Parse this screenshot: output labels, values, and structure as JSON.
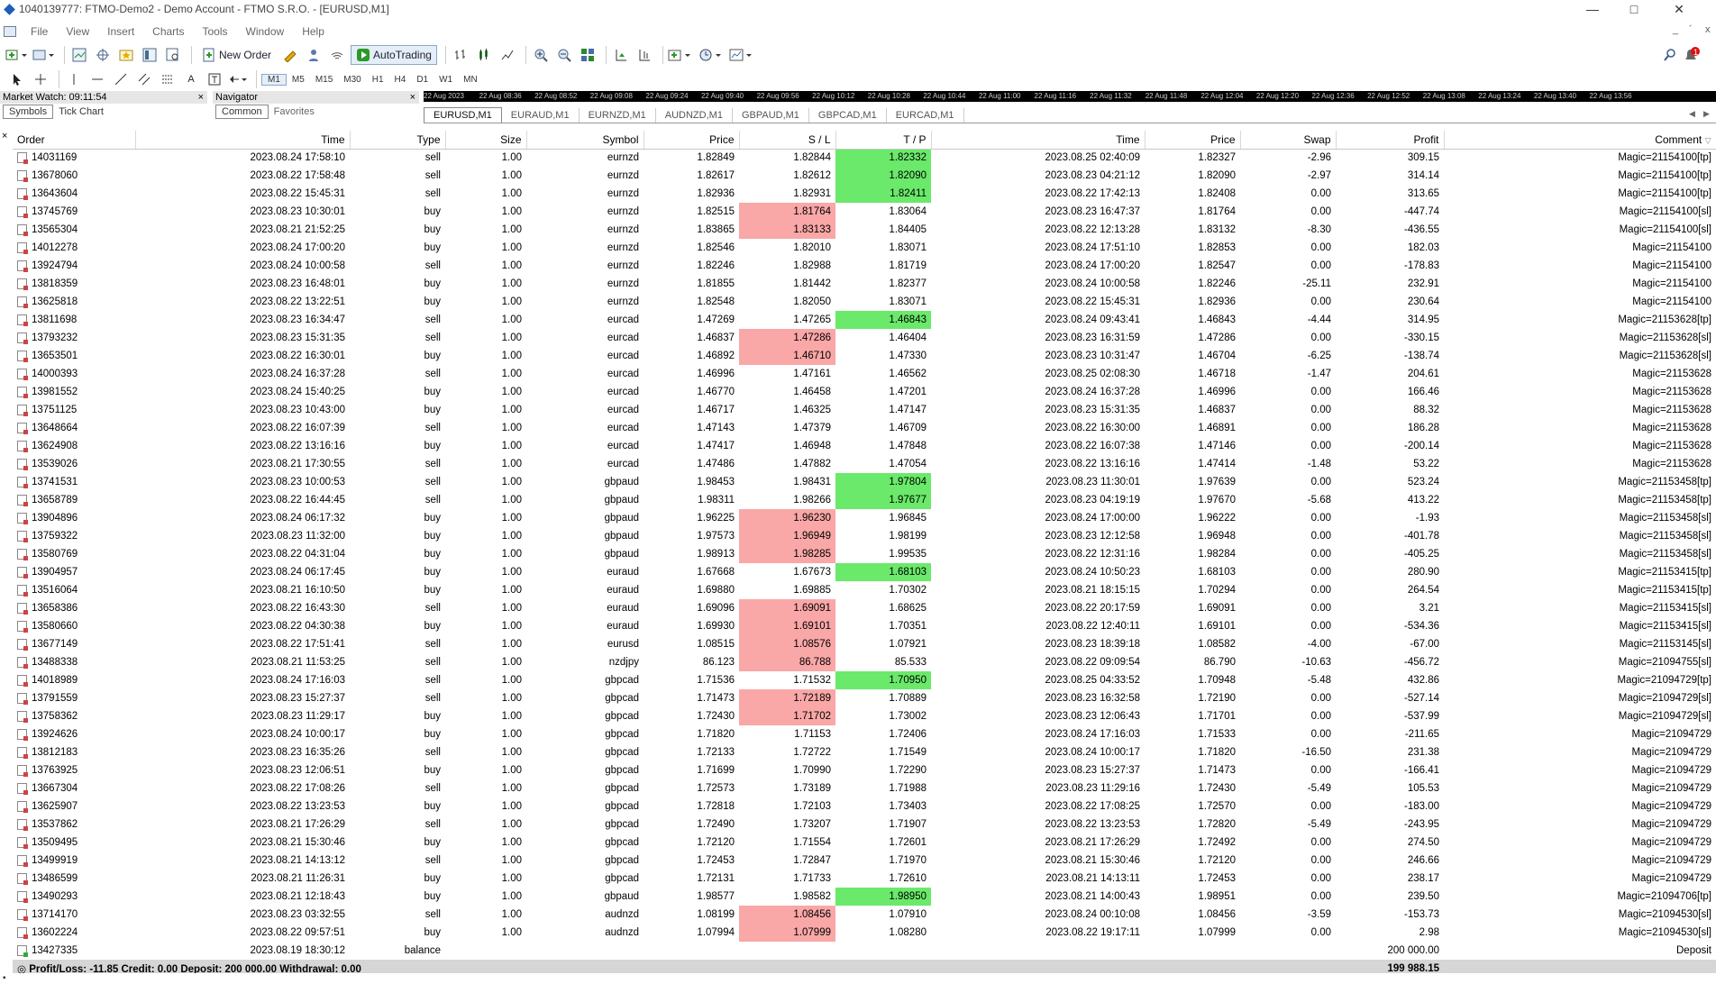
{
  "window": {
    "title": "1040139777: FTMO-Demo2 - Demo Account - FTMO S.R.O. - [EURUSD,M1]",
    "controls": [
      "—",
      "□",
      "✕"
    ]
  },
  "menu": {
    "items": [
      "File",
      "View",
      "Insert",
      "Charts",
      "Tools",
      "Window",
      "Help"
    ],
    "right_controls": [
      "_",
      "´",
      "x"
    ]
  },
  "toolbar": {
    "new_order_label": "New Order",
    "autotrading_label": "AutoTrading",
    "notification_badge": "1"
  },
  "timeframes": [
    "M1",
    "M5",
    "M15",
    "M30",
    "H1",
    "H4",
    "D1",
    "W1",
    "MN"
  ],
  "market_watch": {
    "title": "Market Watch: 09:11:54",
    "tabs": [
      "Symbols",
      "Tick Chart"
    ]
  },
  "navigator": {
    "title": "Navigator",
    "tabs": [
      "Common",
      "Favorites"
    ]
  },
  "chart_strip_times": [
    "22 Aug 2023",
    "22 Aug 08:36",
    "22 Aug 08:52",
    "22 Aug 09:08",
    "22 Aug 09:24",
    "22 Aug 09:40",
    "22 Aug 09:56",
    "22 Aug 10:12",
    "22 Aug 10:28",
    "22 Aug 10:44",
    "22 Aug 11:00",
    "22 Aug 11:16",
    "22 Aug 11:32",
    "22 Aug 11:48",
    "22 Aug 12:04",
    "22 Aug 12:20",
    "22 Aug 12:36",
    "22 Aug 12:52",
    "22 Aug 13:08",
    "22 Aug 13:24",
    "22 Aug 13:40",
    "22 Aug 13:56"
  ],
  "chart_tabs": [
    "EURUSD,M1",
    "EURAUD,M1",
    "EURNZD,M1",
    "AUDNZD,M1",
    "GBPAUD,M1",
    "GBPCAD,M1",
    "EURCAD,M1"
  ],
  "columns": [
    "Order",
    "Time",
    "Type",
    "Size",
    "Symbol",
    "Price",
    "S / L",
    "T / P",
    "Time",
    "Price",
    "Swap",
    "Profit",
    "Comment"
  ],
  "rows": [
    [
      "14031169",
      "2023.08.24 17:58:10",
      "sell",
      "1.00",
      "eurnzd",
      "1.82849",
      "1.82844",
      "1.82332",
      "2023.08.25 02:40:09",
      "1.82327",
      "-2.96",
      "309.15",
      "Magic=21154100[tp]",
      "",
      "tp"
    ],
    [
      "13678060",
      "2023.08.22 17:58:48",
      "sell",
      "1.00",
      "eurnzd",
      "1.82617",
      "1.82612",
      "1.82090",
      "2023.08.23 04:21:12",
      "1.82090",
      "-2.97",
      "314.14",
      "Magic=21154100[tp]",
      "",
      "tp"
    ],
    [
      "13643604",
      "2023.08.22 15:45:31",
      "sell",
      "1.00",
      "eurnzd",
      "1.82936",
      "1.82931",
      "1.82411",
      "2023.08.22 17:42:13",
      "1.82408",
      "0.00",
      "313.65",
      "Magic=21154100[tp]",
      "",
      "tp"
    ],
    [
      "13745769",
      "2023.08.23 10:30:01",
      "buy",
      "1.00",
      "eurnzd",
      "1.82515",
      "1.81764",
      "1.83064",
      "2023.08.23 16:47:37",
      "1.81764",
      "0.00",
      "-447.74",
      "Magic=21154100[sl]",
      "sl",
      ""
    ],
    [
      "13565304",
      "2023.08.21 21:52:25",
      "buy",
      "1.00",
      "eurnzd",
      "1.83865",
      "1.83133",
      "1.84405",
      "2023.08.22 12:13:28",
      "1.83132",
      "-8.30",
      "-436.55",
      "Magic=21154100[sl]",
      "sl",
      ""
    ],
    [
      "14012278",
      "2023.08.24 17:00:20",
      "buy",
      "1.00",
      "eurnzd",
      "1.82546",
      "1.82010",
      "1.83071",
      "2023.08.24 17:51:10",
      "1.82853",
      "0.00",
      "182.03",
      "Magic=21154100",
      "",
      ""
    ],
    [
      "13924794",
      "2023.08.24 10:00:58",
      "sell",
      "1.00",
      "eurnzd",
      "1.82246",
      "1.82988",
      "1.81719",
      "2023.08.24 17:00:20",
      "1.82547",
      "0.00",
      "-178.83",
      "Magic=21154100",
      "",
      ""
    ],
    [
      "13818359",
      "2023.08.23 16:48:01",
      "buy",
      "1.00",
      "eurnzd",
      "1.81855",
      "1.81442",
      "1.82377",
      "2023.08.24 10:00:58",
      "1.82246",
      "-25.11",
      "232.91",
      "Magic=21154100",
      "",
      ""
    ],
    [
      "13625818",
      "2023.08.22 13:22:51",
      "buy",
      "1.00",
      "eurnzd",
      "1.82548",
      "1.82050",
      "1.83071",
      "2023.08.22 15:45:31",
      "1.82936",
      "0.00",
      "230.64",
      "Magic=21154100",
      "",
      ""
    ],
    [
      "13811698",
      "2023.08.23 16:34:47",
      "sell",
      "1.00",
      "eurcad",
      "1.47269",
      "1.47265",
      "1.46843",
      "2023.08.24 09:43:41",
      "1.46843",
      "-4.44",
      "314.95",
      "Magic=21153628[tp]",
      "",
      "tp"
    ],
    [
      "13793232",
      "2023.08.23 15:31:35",
      "sell",
      "1.00",
      "eurcad",
      "1.46837",
      "1.47286",
      "1.46404",
      "2023.08.23 16:31:59",
      "1.47286",
      "0.00",
      "-330.15",
      "Magic=21153628[sl]",
      "sl",
      ""
    ],
    [
      "13653501",
      "2023.08.22 16:30:01",
      "buy",
      "1.00",
      "eurcad",
      "1.46892",
      "1.46710",
      "1.47330",
      "2023.08.23 10:31:47",
      "1.46704",
      "-6.25",
      "-138.74",
      "Magic=21153628[sl]",
      "sl",
      ""
    ],
    [
      "14000393",
      "2023.08.24 16:37:28",
      "sell",
      "1.00",
      "eurcad",
      "1.46996",
      "1.47161",
      "1.46562",
      "2023.08.25 02:08:30",
      "1.46718",
      "-1.47",
      "204.61",
      "Magic=21153628",
      "",
      ""
    ],
    [
      "13981552",
      "2023.08.24 15:40:25",
      "buy",
      "1.00",
      "eurcad",
      "1.46770",
      "1.46458",
      "1.47201",
      "2023.08.24 16:37:28",
      "1.46996",
      "0.00",
      "166.46",
      "Magic=21153628",
      "",
      ""
    ],
    [
      "13751125",
      "2023.08.23 10:43:00",
      "buy",
      "1.00",
      "eurcad",
      "1.46717",
      "1.46325",
      "1.47147",
      "2023.08.23 15:31:35",
      "1.46837",
      "0.00",
      "88.32",
      "Magic=21153628",
      "",
      ""
    ],
    [
      "13648664",
      "2023.08.22 16:07:39",
      "sell",
      "1.00",
      "eurcad",
      "1.47143",
      "1.47379",
      "1.46709",
      "2023.08.22 16:30:00",
      "1.46891",
      "0.00",
      "186.28",
      "Magic=21153628",
      "",
      ""
    ],
    [
      "13624908",
      "2023.08.22 13:16:16",
      "buy",
      "1.00",
      "eurcad",
      "1.47417",
      "1.46948",
      "1.47848",
      "2023.08.22 16:07:38",
      "1.47146",
      "0.00",
      "-200.14",
      "Magic=21153628",
      "",
      ""
    ],
    [
      "13539026",
      "2023.08.21 17:30:55",
      "sell",
      "1.00",
      "eurcad",
      "1.47486",
      "1.47882",
      "1.47054",
      "2023.08.22 13:16:16",
      "1.47414",
      "-1.48",
      "53.22",
      "Magic=21153628",
      "",
      ""
    ],
    [
      "13741531",
      "2023.08.23 10:00:53",
      "sell",
      "1.00",
      "gbpaud",
      "1.98453",
      "1.98431",
      "1.97804",
      "2023.08.23 11:30:01",
      "1.97639",
      "0.00",
      "523.24",
      "Magic=21153458[tp]",
      "",
      "tp"
    ],
    [
      "13658789",
      "2023.08.22 16:44:45",
      "sell",
      "1.00",
      "gbpaud",
      "1.98311",
      "1.98266",
      "1.97677",
      "2023.08.23 04:19:19",
      "1.97670",
      "-5.68",
      "413.22",
      "Magic=21153458[tp]",
      "",
      "tp"
    ],
    [
      "13904896",
      "2023.08.24 06:17:32",
      "buy",
      "1.00",
      "gbpaud",
      "1.96225",
      "1.96230",
      "1.96845",
      "2023.08.24 17:00:00",
      "1.96222",
      "0.00",
      "-1.93",
      "Magic=21153458[sl]",
      "sl",
      ""
    ],
    [
      "13759322",
      "2023.08.23 11:32:00",
      "buy",
      "1.00",
      "gbpaud",
      "1.97573",
      "1.96949",
      "1.98199",
      "2023.08.23 12:12:58",
      "1.96948",
      "0.00",
      "-401.78",
      "Magic=21153458[sl]",
      "sl",
      ""
    ],
    [
      "13580769",
      "2023.08.22 04:31:04",
      "buy",
      "1.00",
      "gbpaud",
      "1.98913",
      "1.98285",
      "1.99535",
      "2023.08.22 12:31:16",
      "1.98284",
      "0.00",
      "-405.25",
      "Magic=21153458[sl]",
      "sl",
      ""
    ],
    [
      "13904957",
      "2023.08.24 06:17:45",
      "buy",
      "1.00",
      "euraud",
      "1.67668",
      "1.67673",
      "1.68103",
      "2023.08.24 10:50:23",
      "1.68103",
      "0.00",
      "280.90",
      "Magic=21153415[tp]",
      "",
      "tp"
    ],
    [
      "13516064",
      "2023.08.21 16:10:50",
      "buy",
      "1.00",
      "euraud",
      "1.69880",
      "1.69885",
      "1.70302",
      "2023.08.21 18:15:15",
      "1.70294",
      "0.00",
      "264.54",
      "Magic=21153415[tp]",
      "",
      ""
    ],
    [
      "13658386",
      "2023.08.22 16:43:30",
      "sell",
      "1.00",
      "euraud",
      "1.69096",
      "1.69091",
      "1.68625",
      "2023.08.22 20:17:59",
      "1.69091",
      "0.00",
      "3.21",
      "Magic=21153415[sl]",
      "sl",
      ""
    ],
    [
      "13580660",
      "2023.08.22 04:30:38",
      "buy",
      "1.00",
      "euraud",
      "1.69930",
      "1.69101",
      "1.70351",
      "2023.08.22 12:40:11",
      "1.69101",
      "0.00",
      "-534.36",
      "Magic=21153415[sl]",
      "sl",
      ""
    ],
    [
      "13677149",
      "2023.08.22 17:51:41",
      "sell",
      "1.00",
      "eurusd",
      "1.08515",
      "1.08576",
      "1.07921",
      "2023.08.23 18:39:18",
      "1.08582",
      "-4.00",
      "-67.00",
      "Magic=21153145[sl]",
      "sl",
      ""
    ],
    [
      "13488338",
      "2023.08.21 11:53:25",
      "sell",
      "1.00",
      "nzdjpy",
      "86.123",
      "86.788",
      "85.533",
      "2023.08.22 09:09:54",
      "86.790",
      "-10.63",
      "-456.72",
      "Magic=21094755[sl]",
      "sl",
      ""
    ],
    [
      "14018989",
      "2023.08.24 17:16:03",
      "sell",
      "1.00",
      "gbpcad",
      "1.71536",
      "1.71532",
      "1.70950",
      "2023.08.25 04:33:52",
      "1.70948",
      "-5.48",
      "432.86",
      "Magic=21094729[tp]",
      "",
      "tp"
    ],
    [
      "13791559",
      "2023.08.23 15:27:37",
      "sell",
      "1.00",
      "gbpcad",
      "1.71473",
      "1.72189",
      "1.70889",
      "2023.08.23 16:32:58",
      "1.72190",
      "0.00",
      "-527.14",
      "Magic=21094729[sl]",
      "sl",
      ""
    ],
    [
      "13758362",
      "2023.08.23 11:29:17",
      "buy",
      "1.00",
      "gbpcad",
      "1.72430",
      "1.71702",
      "1.73002",
      "2023.08.23 12:06:43",
      "1.71701",
      "0.00",
      "-537.99",
      "Magic=21094729[sl]",
      "sl",
      ""
    ],
    [
      "13924626",
      "2023.08.24 10:00:17",
      "buy",
      "1.00",
      "gbpcad",
      "1.71820",
      "1.71153",
      "1.72406",
      "2023.08.24 17:16:03",
      "1.71533",
      "0.00",
      "-211.65",
      "Magic=21094729",
      "",
      ""
    ],
    [
      "13812183",
      "2023.08.23 16:35:26",
      "sell",
      "1.00",
      "gbpcad",
      "1.72133",
      "1.72722",
      "1.71549",
      "2023.08.24 10:00:17",
      "1.71820",
      "-16.50",
      "231.38",
      "Magic=21094729",
      "",
      ""
    ],
    [
      "13763925",
      "2023.08.23 12:06:51",
      "buy",
      "1.00",
      "gbpcad",
      "1.71699",
      "1.70990",
      "1.72290",
      "2023.08.23 15:27:37",
      "1.71473",
      "0.00",
      "-166.41",
      "Magic=21094729",
      "",
      ""
    ],
    [
      "13667304",
      "2023.08.22 17:08:26",
      "sell",
      "1.00",
      "gbpcad",
      "1.72573",
      "1.73189",
      "1.71988",
      "2023.08.23 11:29:16",
      "1.72430",
      "-5.49",
      "105.53",
      "Magic=21094729",
      "",
      ""
    ],
    [
      "13625907",
      "2023.08.22 13:23:53",
      "buy",
      "1.00",
      "gbpcad",
      "1.72818",
      "1.72103",
      "1.73403",
      "2023.08.22 17:08:25",
      "1.72570",
      "0.00",
      "-183.00",
      "Magic=21094729",
      "",
      ""
    ],
    [
      "13537862",
      "2023.08.21 17:26:29",
      "sell",
      "1.00",
      "gbpcad",
      "1.72490",
      "1.73207",
      "1.71907",
      "2023.08.22 13:23:53",
      "1.72820",
      "-5.49",
      "-243.95",
      "Magic=21094729",
      "",
      ""
    ],
    [
      "13509495",
      "2023.08.21 15:30:46",
      "buy",
      "1.00",
      "gbpcad",
      "1.72120",
      "1.71554",
      "1.72601",
      "2023.08.21 17:26:29",
      "1.72492",
      "0.00",
      "274.50",
      "Magic=21094729",
      "",
      ""
    ],
    [
      "13499919",
      "2023.08.21 14:13:12",
      "sell",
      "1.00",
      "gbpcad",
      "1.72453",
      "1.72847",
      "1.71970",
      "2023.08.21 15:30:46",
      "1.72120",
      "0.00",
      "246.66",
      "Magic=21094729",
      "",
      ""
    ],
    [
      "13486599",
      "2023.08.21 11:26:31",
      "buy",
      "1.00",
      "gbpcad",
      "1.72131",
      "1.71733",
      "1.72610",
      "2023.08.21 14:13:11",
      "1.72453",
      "0.00",
      "238.17",
      "Magic=21094729",
      "",
      ""
    ],
    [
      "13490293",
      "2023.08.21 12:18:43",
      "buy",
      "1.00",
      "gbpaud",
      "1.98577",
      "1.98582",
      "1.98950",
      "2023.08.21 14:00:43",
      "1.98951",
      "0.00",
      "239.50",
      "Magic=21094706[tp]",
      "",
      "tp"
    ],
    [
      "13714170",
      "2023.08.23 03:32:55",
      "sell",
      "1.00",
      "audnzd",
      "1.08199",
      "1.08456",
      "1.07910",
      "2023.08.24 00:10:08",
      "1.08456",
      "-3.59",
      "-153.73",
      "Magic=21094530[sl]",
      "sl",
      ""
    ],
    [
      "13602224",
      "2023.08.22 09:57:51",
      "buy",
      "1.00",
      "audnzd",
      "1.07994",
      "1.07999",
      "1.08280",
      "2023.08.22 19:17:11",
      "1.07999",
      "0.00",
      "2.98",
      "Magic=21094530[sl]",
      "sl",
      ""
    ]
  ],
  "balance_row": {
    "order": "13427335",
    "time": "2023.08.19 18:30:12",
    "type": "balance",
    "profit": "200 000.00",
    "comment": "Deposit"
  },
  "summary": {
    "text": "Profit/Loss: -11.85  Credit: 0.00  Deposit: 200 000.00  Withdrawal: 0.00",
    "total": "199 988.15"
  },
  "colors": {
    "sl_hit": "#f9a7a7",
    "tp_hit": "#6ae96a",
    "summary_bg": "#d6d6d6"
  }
}
